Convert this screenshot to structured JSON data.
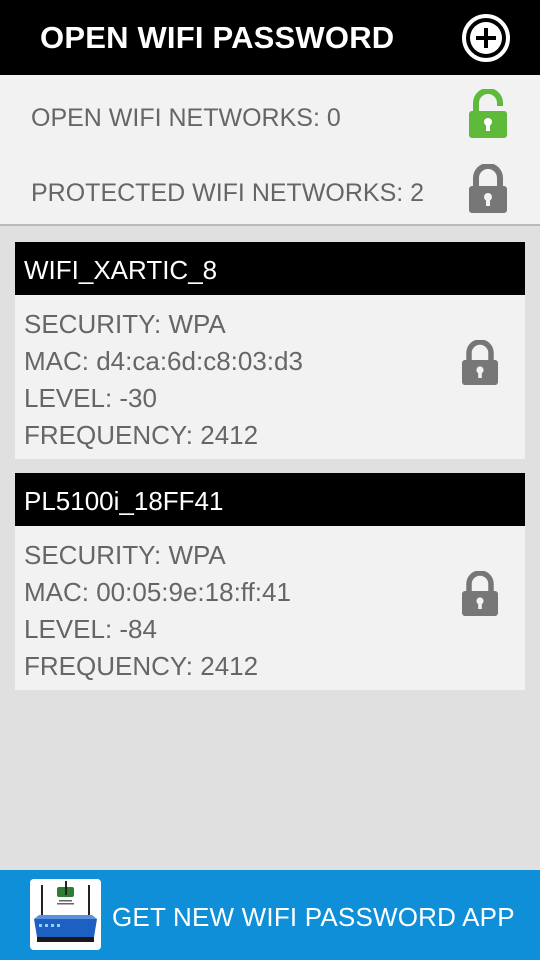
{
  "header": {
    "title": "OPEN WIFI PASSWORD",
    "add_icon": "plus-circle-icon"
  },
  "summary": {
    "open_label": "OPEN WIFI NETWORKS: 0",
    "protected_label": "PROTECTED WIFI NETWORKS: 2",
    "open_icon": "unlocked-icon",
    "protected_icon": "lock-icon",
    "colors": {
      "open_lock": "#5fba3b",
      "protected_lock": "#777777"
    }
  },
  "networks": [
    {
      "ssid": "WIFI_XARTIC_8",
      "security": "SECURITY: WPA",
      "mac": "MAC: d4:ca:6d:c8:03:d3",
      "level": "LEVEL: -30",
      "frequency": "FREQUENCY: 2412",
      "icon": "lock-icon"
    },
    {
      "ssid": "PL5100i_18FF41",
      "security": "SECURITY: WPA",
      "mac": "MAC: 00:05:9e:18:ff:41",
      "level": "LEVEL: -84",
      "frequency": "FREQUENCY: 2412",
      "icon": "lock-icon"
    }
  ],
  "banner": {
    "label": "GET NEW WIFI PASSWORD APP",
    "icon": "router-app-icon",
    "color": "#0e8fd8"
  }
}
